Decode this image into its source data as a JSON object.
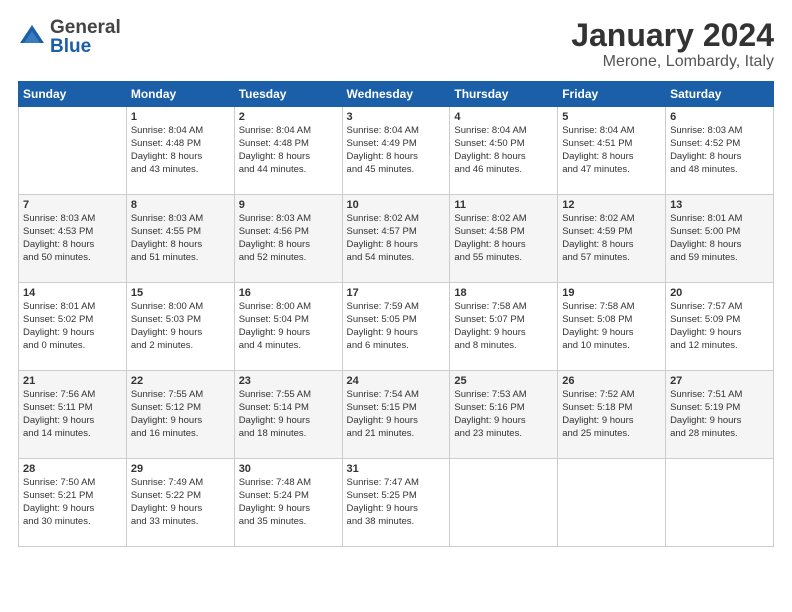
{
  "header": {
    "logo_general": "General",
    "logo_blue": "Blue",
    "title": "January 2024",
    "subtitle": "Merone, Lombardy, Italy"
  },
  "calendar": {
    "days_of_week": [
      "Sunday",
      "Monday",
      "Tuesday",
      "Wednesday",
      "Thursday",
      "Friday",
      "Saturday"
    ],
    "weeks": [
      [
        {
          "day": "",
          "info": ""
        },
        {
          "day": "1",
          "info": "Sunrise: 8:04 AM\nSunset: 4:48 PM\nDaylight: 8 hours\nand 43 minutes."
        },
        {
          "day": "2",
          "info": "Sunrise: 8:04 AM\nSunset: 4:48 PM\nDaylight: 8 hours\nand 44 minutes."
        },
        {
          "day": "3",
          "info": "Sunrise: 8:04 AM\nSunset: 4:49 PM\nDaylight: 8 hours\nand 45 minutes."
        },
        {
          "day": "4",
          "info": "Sunrise: 8:04 AM\nSunset: 4:50 PM\nDaylight: 8 hours\nand 46 minutes."
        },
        {
          "day": "5",
          "info": "Sunrise: 8:04 AM\nSunset: 4:51 PM\nDaylight: 8 hours\nand 47 minutes."
        },
        {
          "day": "6",
          "info": "Sunrise: 8:03 AM\nSunset: 4:52 PM\nDaylight: 8 hours\nand 48 minutes."
        }
      ],
      [
        {
          "day": "7",
          "info": "Sunrise: 8:03 AM\nSunset: 4:53 PM\nDaylight: 8 hours\nand 50 minutes."
        },
        {
          "day": "8",
          "info": "Sunrise: 8:03 AM\nSunset: 4:55 PM\nDaylight: 8 hours\nand 51 minutes."
        },
        {
          "day": "9",
          "info": "Sunrise: 8:03 AM\nSunset: 4:56 PM\nDaylight: 8 hours\nand 52 minutes."
        },
        {
          "day": "10",
          "info": "Sunrise: 8:02 AM\nSunset: 4:57 PM\nDaylight: 8 hours\nand 54 minutes."
        },
        {
          "day": "11",
          "info": "Sunrise: 8:02 AM\nSunset: 4:58 PM\nDaylight: 8 hours\nand 55 minutes."
        },
        {
          "day": "12",
          "info": "Sunrise: 8:02 AM\nSunset: 4:59 PM\nDaylight: 8 hours\nand 57 minutes."
        },
        {
          "day": "13",
          "info": "Sunrise: 8:01 AM\nSunset: 5:00 PM\nDaylight: 8 hours\nand 59 minutes."
        }
      ],
      [
        {
          "day": "14",
          "info": "Sunrise: 8:01 AM\nSunset: 5:02 PM\nDaylight: 9 hours\nand 0 minutes."
        },
        {
          "day": "15",
          "info": "Sunrise: 8:00 AM\nSunset: 5:03 PM\nDaylight: 9 hours\nand 2 minutes."
        },
        {
          "day": "16",
          "info": "Sunrise: 8:00 AM\nSunset: 5:04 PM\nDaylight: 9 hours\nand 4 minutes."
        },
        {
          "day": "17",
          "info": "Sunrise: 7:59 AM\nSunset: 5:05 PM\nDaylight: 9 hours\nand 6 minutes."
        },
        {
          "day": "18",
          "info": "Sunrise: 7:58 AM\nSunset: 5:07 PM\nDaylight: 9 hours\nand 8 minutes."
        },
        {
          "day": "19",
          "info": "Sunrise: 7:58 AM\nSunset: 5:08 PM\nDaylight: 9 hours\nand 10 minutes."
        },
        {
          "day": "20",
          "info": "Sunrise: 7:57 AM\nSunset: 5:09 PM\nDaylight: 9 hours\nand 12 minutes."
        }
      ],
      [
        {
          "day": "21",
          "info": "Sunrise: 7:56 AM\nSunset: 5:11 PM\nDaylight: 9 hours\nand 14 minutes."
        },
        {
          "day": "22",
          "info": "Sunrise: 7:55 AM\nSunset: 5:12 PM\nDaylight: 9 hours\nand 16 minutes."
        },
        {
          "day": "23",
          "info": "Sunrise: 7:55 AM\nSunset: 5:14 PM\nDaylight: 9 hours\nand 18 minutes."
        },
        {
          "day": "24",
          "info": "Sunrise: 7:54 AM\nSunset: 5:15 PM\nDaylight: 9 hours\nand 21 minutes."
        },
        {
          "day": "25",
          "info": "Sunrise: 7:53 AM\nSunset: 5:16 PM\nDaylight: 9 hours\nand 23 minutes."
        },
        {
          "day": "26",
          "info": "Sunrise: 7:52 AM\nSunset: 5:18 PM\nDaylight: 9 hours\nand 25 minutes."
        },
        {
          "day": "27",
          "info": "Sunrise: 7:51 AM\nSunset: 5:19 PM\nDaylight: 9 hours\nand 28 minutes."
        }
      ],
      [
        {
          "day": "28",
          "info": "Sunrise: 7:50 AM\nSunset: 5:21 PM\nDaylight: 9 hours\nand 30 minutes."
        },
        {
          "day": "29",
          "info": "Sunrise: 7:49 AM\nSunset: 5:22 PM\nDaylight: 9 hours\nand 33 minutes."
        },
        {
          "day": "30",
          "info": "Sunrise: 7:48 AM\nSunset: 5:24 PM\nDaylight: 9 hours\nand 35 minutes."
        },
        {
          "day": "31",
          "info": "Sunrise: 7:47 AM\nSunset: 5:25 PM\nDaylight: 9 hours\nand 38 minutes."
        },
        {
          "day": "",
          "info": ""
        },
        {
          "day": "",
          "info": ""
        },
        {
          "day": "",
          "info": ""
        }
      ]
    ]
  }
}
